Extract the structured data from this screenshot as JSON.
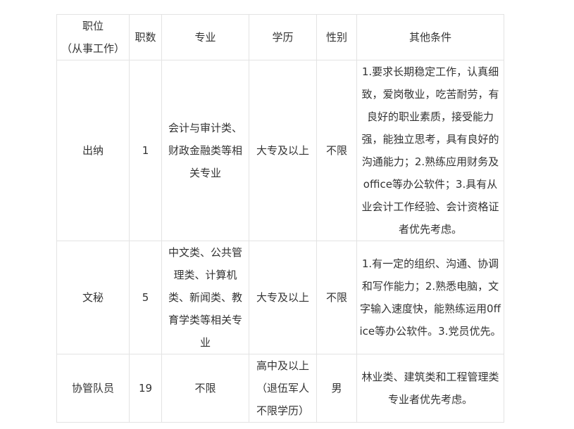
{
  "table": {
    "headers": [
      "职位\n（从事工作）",
      "职数",
      "专业",
      "学历",
      "性别",
      "其他条件"
    ],
    "rows": [
      {
        "position": "出纳",
        "count": "1",
        "major": "会计与审计类、财政金融类等相关专业",
        "education": "大专及以上",
        "gender": "不限",
        "other": "1.要求长期稳定工作，认真细致，爱岗敬业，吃苦耐劳，有良好的职业素质，接受能力强，能独立思考，具有良好的沟通能力；2.熟练应用财务及office等办公软件；3.具有从业会计工作经验、会计资格证者优先考虑。"
      },
      {
        "position": "文秘",
        "count": "5",
        "major": "中文类、公共管理类、计算机类、新闻类、教育学类等相关专业",
        "education": "大专及以上",
        "gender": "不限",
        "other": "1.有一定的组织、沟通、协调和写作能力；2.熟悉电脑，文字输入速度快，能熟练运用0ffice等办公软件。3.党员优先。"
      },
      {
        "position": "协管队员",
        "count": "19",
        "major": "不限",
        "education": "高中及以上（退伍军人不限学历）",
        "gender": "男",
        "other": "林业类、建筑类和工程管理类专业者优先考虑。"
      }
    ]
  }
}
